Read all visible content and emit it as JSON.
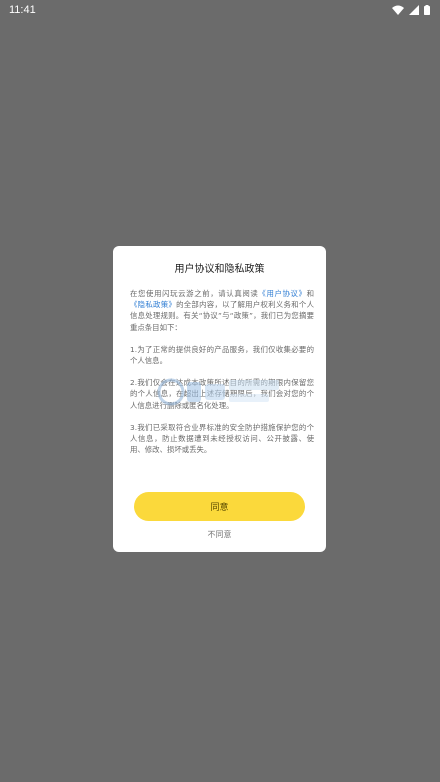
{
  "status_bar": {
    "time": "11:41",
    "icons": [
      "wifi-icon",
      "signal-icon",
      "battery-icon"
    ]
  },
  "dialog": {
    "title": "用户协议和隐私政策",
    "intro": {
      "part1": "在您使用闪玩云游之前，请认真阅读",
      "link_user_agreement": "《用户协议》",
      "and": "和",
      "link_privacy_policy": "《隐私政策》",
      "part2": "的全部内容，以了解用户权利义务和个人信息处理规则。有关“协议”与“政策”，我们已为您摘要重点条目如下："
    },
    "points": [
      "1.为了正常的提供良好的产品服务，我们仅收集必要的个人信息。",
      "2.我们仅会在达成本政策所述目的所需的期限内保留您的个人信息，在超出上述存储期限后，我们会对您的个人信息进行删除或匿名化处理。",
      "3.我们已采取符合业界标准的安全防护措施保护您的个人信息，防止数据遭到未经授权访问、公开披露、使用、修改、损坏或丢失。"
    ],
    "agree_label": "同意",
    "disagree_label": "不同意"
  },
  "colors": {
    "overlay": "#6b6b6b",
    "accent_button": "#fbd93b",
    "link": "#2f7dd3"
  }
}
